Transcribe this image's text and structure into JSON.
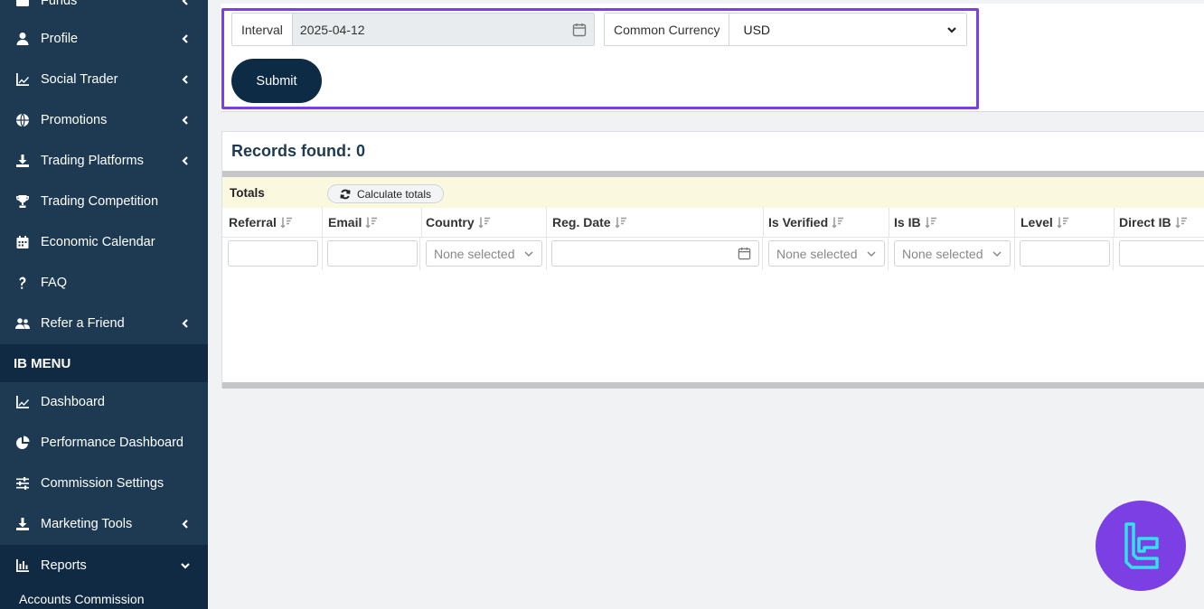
{
  "sidebar": {
    "items": [
      {
        "label": "Funds",
        "icon": "wallet-icon"
      },
      {
        "label": "Profile",
        "icon": "user-icon"
      },
      {
        "label": "Social Trader",
        "icon": "chart-line-icon"
      },
      {
        "label": "Promotions",
        "icon": "globe-icon"
      },
      {
        "label": "Trading Platforms",
        "icon": "download-icon"
      },
      {
        "label": "Trading Competition",
        "icon": "trophy-icon"
      },
      {
        "label": "Economic Calendar",
        "icon": "calendar-icon"
      },
      {
        "label": "FAQ",
        "icon": "question-icon"
      },
      {
        "label": "Refer a Friend",
        "icon": "users-icon"
      }
    ],
    "section_title": "IB MENU",
    "ib_items": [
      {
        "label": "Dashboard",
        "icon": "chart-line-icon"
      },
      {
        "label": "Performance Dashboard",
        "icon": "pie-chart-icon"
      },
      {
        "label": "Commission Settings",
        "icon": "sliders-icon"
      },
      {
        "label": "Marketing Tools",
        "icon": "download-icon"
      },
      {
        "label": "Reports",
        "icon": "bar-chart-icon"
      }
    ],
    "sub_item": "Accounts Commission"
  },
  "filters": {
    "interval_label": "Interval",
    "interval_value": "2025-04-12",
    "currency_label": "Common Currency",
    "currency_value": "USD",
    "submit_label": "Submit"
  },
  "records": {
    "title": "Records found: 0",
    "totals_label": "Totals",
    "calc_label": "Calculate totals",
    "columns": [
      "Referral",
      "Email",
      "Country",
      "Reg. Date",
      "Is Verified",
      "Is IB",
      "Level",
      "Direct IB"
    ],
    "placeholder_none": "None selected"
  },
  "colors": {
    "sidebar_bg": "#1d3a52",
    "sidebar_active": "#0f2a42",
    "highlight": "#7b3fe4",
    "submit_bg": "#0d2b45",
    "totals_bg": "#fbf8e0",
    "logo_bg": "#7b3fe4",
    "logo_accent": "#35e0e8"
  }
}
